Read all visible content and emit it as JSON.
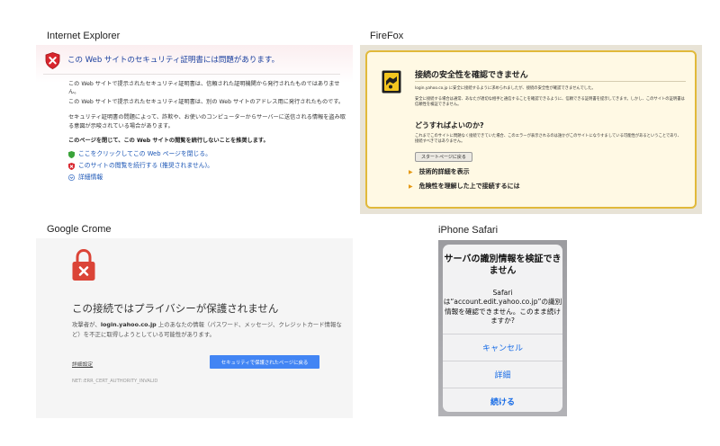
{
  "captions": {
    "ie": "Internet Explorer",
    "firefox": "FireFox",
    "chrome": "Google Crome",
    "safari": "iPhone Safari"
  },
  "ie": {
    "title": "この Web サイトのセキュリティ証明書には問題があります。",
    "para1": "この Web サイトで提示されたセキュリティ証明書は、信頼された証明機関から発行されたものではありません。",
    "para2": "この Web サイトで提示されたセキュリティ証明書は、別の Web サイトのアドレス用に発行されたものです。",
    "para3": "セキュリティ証明書の問題によって、詐欺や、お使いのコンピューターからサーバーに送信される情報を盗み取る意図が示唆されている場合があります。",
    "recommend": "このページを閉じて、この Web サイトの閲覧を続行しないことを推奨します。",
    "close_link": "ここをクリックしてこの Web ページを閉じる。",
    "continue_link": "このサイトの閲覧を続行する (推奨されません)。",
    "details_link": "詳細情報"
  },
  "firefox": {
    "title": "接続の安全性を確認できません",
    "desc1": "login.yahoo.co.jp に安全に接続するように求められましたが、接続の安全性が確認できませんでした。",
    "desc2": "安全に接続する場合は通常、あなたが適切な相手と通信することを確認できるように、信頼できる証明書を提示してきます。しかし、このサイトの証明書は信頼性を検証できません。",
    "what_heading": "どうすればよいのか?",
    "desc3": "これまでこのサイトに問題なく接続できていた場合、このエラーが表示されるのは誰かがこのサイトになりすましている可能性があるということであり、接続すべきではありません。",
    "back_button": "スタートページに戻る",
    "tech_details": "技術的詳細を表示",
    "add_exception": "危険性を理解した上で接続するには"
  },
  "chrome": {
    "title": "この接続ではプライバシーが保護されません",
    "text_prefix": "攻撃者が、",
    "domain": "login.yahoo.co.jp",
    "text_suffix": " 上のあなたの情報（パスワード、メッセージ、クレジットカード情報など）を不正に取得しようとしている可能性があります。",
    "advanced": "詳細設定",
    "back_button": "セキュリティで保護されたページに戻る",
    "error_code": "NET::ERR_CERT_AUTHORITY_INVALID"
  },
  "safari": {
    "title": "サーバの識別情報を検証できません",
    "message": "Safariは“account.edit.yahoo.co.jp”の識別情報を確認できません。このまま続けますか?",
    "cancel": "キャンセル",
    "details": "詳細",
    "continue": "続ける"
  },
  "colors": {
    "ie_link": "#1a55b5",
    "ie_title": "#1a3f9e",
    "ff_border": "#e1b93a",
    "chrome_red": "#db4437",
    "chrome_button": "#4285f4",
    "ios_blue": "#1a6de6"
  }
}
